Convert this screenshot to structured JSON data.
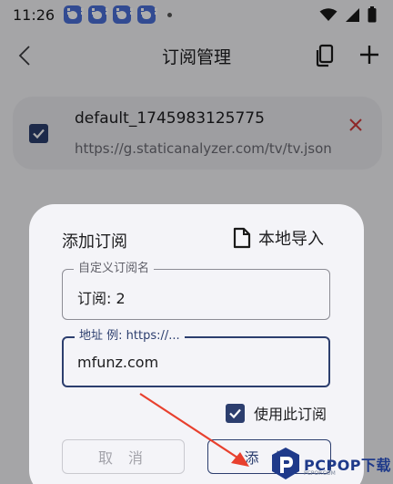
{
  "status_bar": {
    "time": "11:26",
    "notification_icons": [
      "baidu-paw-icon",
      "baidu-paw-icon",
      "baidu-paw-icon",
      "baidu-paw-icon"
    ],
    "indicators": [
      "wifi-icon",
      "signal-icon",
      "battery-icon"
    ]
  },
  "app_bar": {
    "title": "订阅管理",
    "back_icon": "chevron-left-icon",
    "actions": [
      "copy-icon",
      "plus-icon"
    ]
  },
  "subscription": {
    "name": "default_1745983125775",
    "url": "https://g.staticanalyzer.com/tv/tv.json",
    "checked": true,
    "delete_icon": "close-icon"
  },
  "dialog": {
    "title": "添加订阅",
    "import_label": "本地导入",
    "name_field": {
      "label": "自定义订阅名",
      "value": "订阅: 2"
    },
    "url_field": {
      "label": "地址 例: https://...",
      "value": "mfunz.com"
    },
    "use_label": "使用此订阅",
    "use_checked": true,
    "cancel_label": "取 消",
    "add_label": "添 加"
  },
  "watermark": {
    "text": "PCPOP下载",
    "subtext": "PCPOP.COM"
  },
  "colors": {
    "accent": "#2c3e6e",
    "delete": "#d23b3b",
    "arrow": "#e8402e",
    "watermark": "#1f3a8a"
  }
}
